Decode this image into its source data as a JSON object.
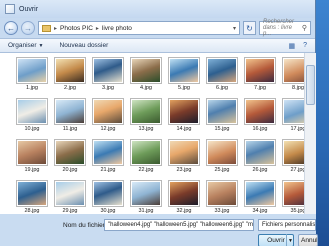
{
  "window": {
    "title": "Ouvrir"
  },
  "address": {
    "path": [
      "Photos PIC",
      "livre photo"
    ],
    "search_placeholder": "Rechercher dans : livre p..."
  },
  "toolbar": {
    "organize": "Organiser",
    "new_folder": "Nouveau dossier"
  },
  "files": [
    {
      "name": "1.jpg",
      "palette": "p0"
    },
    {
      "name": "2.jpg",
      "palette": "p1"
    },
    {
      "name": "3.jpg",
      "palette": "p2"
    },
    {
      "name": "4.jpg",
      "palette": "p3"
    },
    {
      "name": "5.jpg",
      "palette": "p4"
    },
    {
      "name": "6.jpg",
      "palette": "p5"
    },
    {
      "name": "7.jpg",
      "palette": "p6"
    },
    {
      "name": "8.jpg",
      "palette": "p7"
    },
    {
      "name": "10.jpg",
      "palette": "p8"
    },
    {
      "name": "11.jpg",
      "palette": "p9"
    },
    {
      "name": "12.jpg",
      "palette": "p10"
    },
    {
      "name": "13.jpg",
      "palette": "p11"
    },
    {
      "name": "14.jpg",
      "palette": "p12"
    },
    {
      "name": "15.jpg",
      "palette": "p13"
    },
    {
      "name": "16.jpg",
      "palette": "p6"
    },
    {
      "name": "17.jpg",
      "palette": "p0"
    },
    {
      "name": "19.jpg",
      "palette": "p14"
    },
    {
      "name": "20.jpg",
      "palette": "p3"
    },
    {
      "name": "21.jpg",
      "palette": "p4"
    },
    {
      "name": "22.jpg",
      "palette": "p11"
    },
    {
      "name": "23.jpg",
      "palette": "p10"
    },
    {
      "name": "25.jpg",
      "palette": "p7"
    },
    {
      "name": "26.jpg",
      "palette": "p13"
    },
    {
      "name": "27.jpg",
      "palette": "p1"
    },
    {
      "name": "28.jpg",
      "palette": "p5"
    },
    {
      "name": "29.jpg",
      "palette": "p8"
    },
    {
      "name": "30.jpg",
      "palette": "p2"
    },
    {
      "name": "31.jpg",
      "palette": "p9"
    },
    {
      "name": "32.jpg",
      "palette": "p12"
    },
    {
      "name": "33.jpg",
      "palette": "p14"
    },
    {
      "name": "34.jpg",
      "palette": "p4"
    },
    {
      "name": "35.jpg",
      "palette": "p6"
    }
  ],
  "bottom": {
    "filename_label": "Nom du fichier :",
    "filename_value": "\"halloween4.jpg\" \"halloween5.jpg\" \"halloween6.jpg\" \"mariage",
    "filetype": "Fichiers personnalisés",
    "open": "Ouvrir",
    "cancel": "Annuler"
  }
}
